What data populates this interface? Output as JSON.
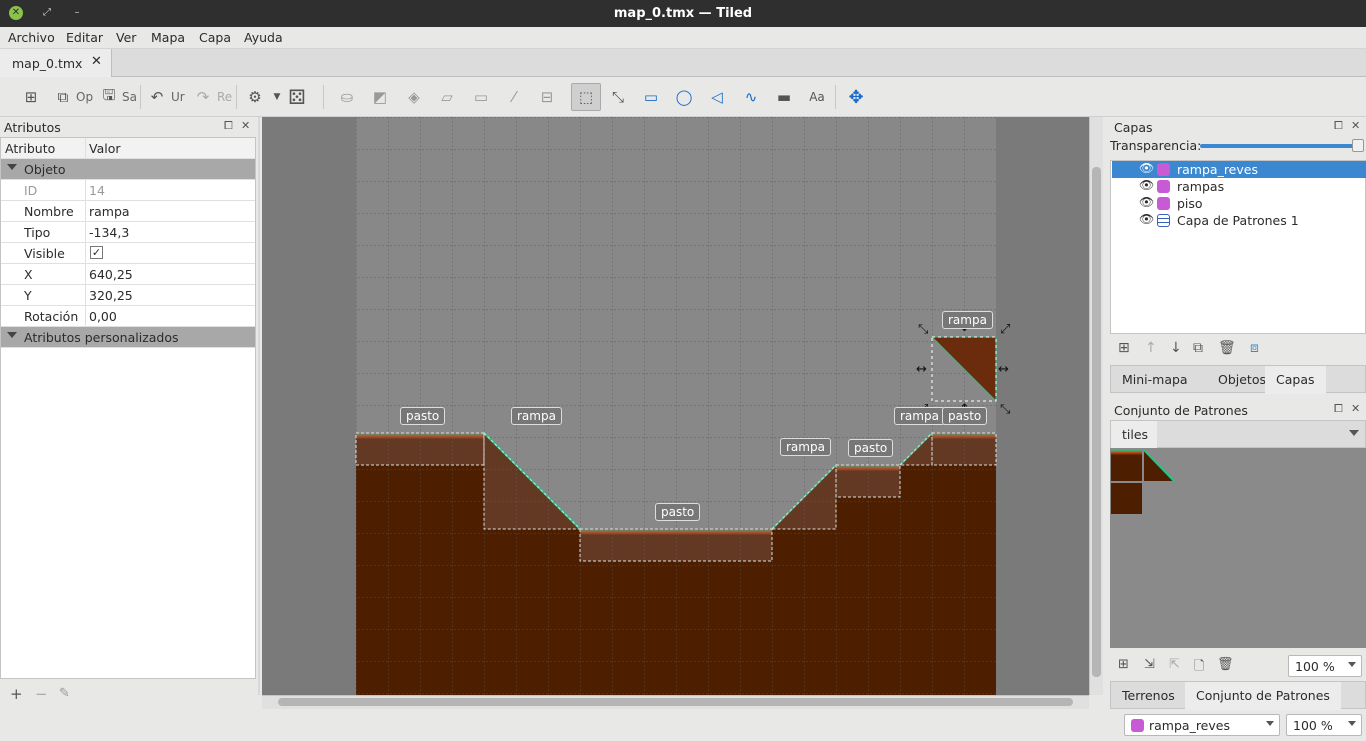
{
  "window": {
    "title": "map_0.tmx — Tiled"
  },
  "menu": [
    "Archivo",
    "Editar",
    "Ver",
    "Mapa",
    "Capa",
    "Ayuda"
  ],
  "tab": {
    "label": "map_0.tmx"
  },
  "toolbar": {
    "open_label": "Op",
    "save_label": "Sa",
    "undo_label": "Ur",
    "redo_label": "Re"
  },
  "properties": {
    "title": "Atributos",
    "col_attr": "Atributo",
    "col_value": "Valor",
    "group_object": "Objeto",
    "rows": [
      {
        "k": "ID",
        "v": "14"
      },
      {
        "k": "Nombre",
        "v": "rampa"
      },
      {
        "k": "Tipo",
        "v": "-134,3"
      },
      {
        "k": "Visible",
        "v": "✓"
      },
      {
        "k": "X",
        "v": "640,25"
      },
      {
        "k": "Y",
        "v": "320,25"
      },
      {
        "k": "Rotación",
        "v": "0,00"
      }
    ],
    "group_custom": "Atributos personalizados"
  },
  "map_labels": {
    "pasto": "pasto",
    "rampa": "rampa"
  },
  "layers": {
    "title": "Capas",
    "opacity_label": "Transparencia:",
    "items": [
      {
        "name": "rampa_reves",
        "type": "object",
        "selected": true
      },
      {
        "name": "rampas",
        "type": "object",
        "selected": false
      },
      {
        "name": "piso",
        "type": "object",
        "selected": false
      },
      {
        "name": "Capa de Patrones 1",
        "type": "tile",
        "selected": false
      }
    ]
  },
  "side_tabs": [
    "Mini-mapa",
    "Objetos",
    "Capas"
  ],
  "tilesets": {
    "title": "Conjunto de Patrones",
    "tab": "tiles",
    "zoom": "100 %"
  },
  "bottom_tabs": [
    "Terrenos",
    "Conjunto de Patrones"
  ],
  "status": {
    "layer": "rampa_reves",
    "zoom": "100 %"
  },
  "colors": {
    "selection": "#3b88d1",
    "dirt": "#4d1e00",
    "grass": "#22a07a",
    "canvas": "#7a7a7a"
  }
}
